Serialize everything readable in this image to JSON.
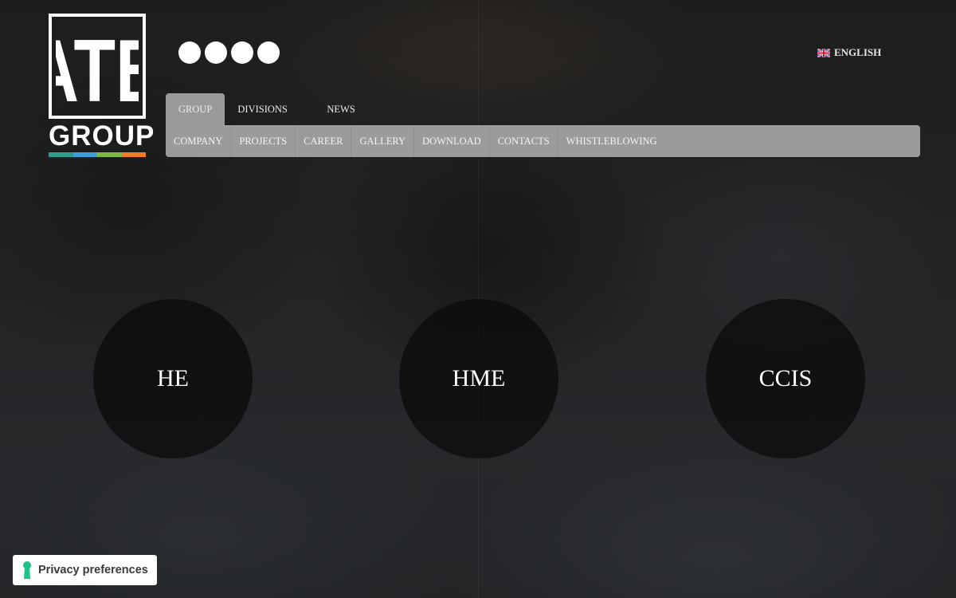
{
  "logo": {
    "letters": "ATB",
    "wordmark": "GROUP",
    "bar_colors": [
      "#2a9d8f",
      "#3aa0d8",
      "#7dbb42",
      "#f07c22"
    ]
  },
  "social": {
    "icons": [
      "facebook-icon",
      "twitter-icon",
      "linkedin-icon",
      "youtube-icon"
    ]
  },
  "language": {
    "label": "ENGLISH",
    "flag": "uk-flag-icon"
  },
  "nav": {
    "top_tabs": [
      {
        "label": "GROUP",
        "active": true
      },
      {
        "label": "DIVISIONS",
        "active": false
      },
      {
        "label": "NEWS",
        "active": false
      }
    ],
    "sub_items": [
      {
        "label": "COMPANY"
      },
      {
        "label": "PROJECTS"
      },
      {
        "label": "CAREER"
      },
      {
        "label": "GALLERY"
      },
      {
        "label": "DOWNLOAD"
      },
      {
        "label": "CONTACTS"
      },
      {
        "label": "WHISTLEBLOWING"
      }
    ]
  },
  "divisions": [
    {
      "label": "HE"
    },
    {
      "label": "HME"
    },
    {
      "label": "CCIS"
    }
  ],
  "privacy": {
    "label": "Privacy preferences",
    "icon": "keyhole-icon",
    "accent": "#1ec28b"
  },
  "colors": {
    "nav_bg": "#9b9b9b",
    "background": "#1f2022"
  }
}
